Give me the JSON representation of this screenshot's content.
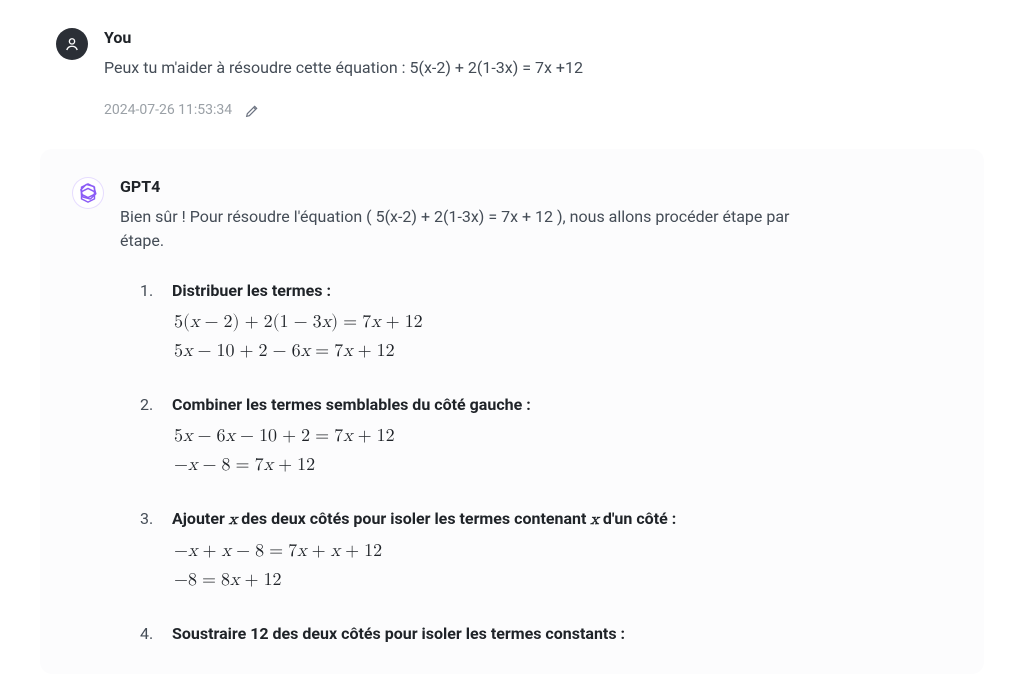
{
  "user": {
    "sender_label": "You",
    "text": "Peux tu m'aider à résoudre cette équation : 5(x-2) + 2(1-3x) = 7x +12",
    "timestamp": "2024-07-26 11:53:34"
  },
  "assistant": {
    "sender_label": "GPT4",
    "intro": "Bien sûr ! Pour résoudre l'équation ( 5(x-2) + 2(1-3x) = 7x + 12 ), nous allons procéder étape par étape.",
    "steps": [
      {
        "title": "Distribuer les termes :",
        "equations": [
          "5(x − 2) + 2(1 − 3x) = 7x + 12",
          "5x − 10 + 2 − 6x = 7x + 12"
        ]
      },
      {
        "title": "Combiner les termes semblables du côté gauche :",
        "equations": [
          "5x − 6x − 10 + 2 = 7x + 12",
          "−x − 8 = 7x + 12"
        ]
      },
      {
        "title_parts": [
          "Ajouter ",
          "x",
          " des deux côtés pour isoler les termes contenant ",
          "x",
          " d'un côté :"
        ],
        "equations": [
          "−x + x − 8 = 7x + x + 12",
          "−8 = 8x + 12"
        ]
      },
      {
        "title": "Soustraire 12 des deux côtés pour isoler les termes constants :",
        "equations": []
      }
    ]
  }
}
